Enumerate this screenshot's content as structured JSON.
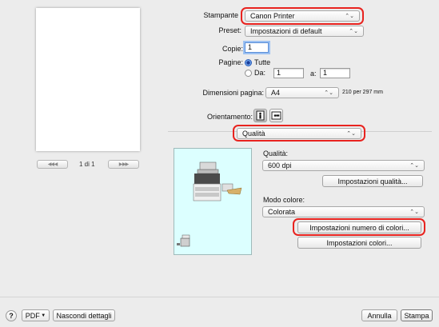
{
  "preview": {
    "page_indicator": "1 di 1",
    "first_icon": "◀◀ ◀",
    "last_icon": "▶ ▶▶"
  },
  "printer": {
    "label": "Stampante",
    "value": "Canon Printer"
  },
  "preset": {
    "label": "Preset:",
    "value": "Impostazioni di default"
  },
  "copies": {
    "label": "Copie:",
    "value": "1"
  },
  "pages": {
    "label": "Pagine:",
    "all_label": "Tutte",
    "from_label": "Da:",
    "from_value": "1",
    "to_label": "a:",
    "to_value": "1"
  },
  "paper": {
    "label": "Dimensioni pagina:",
    "value": "A4",
    "size_note": "210 per 297 mm"
  },
  "orientation": {
    "label": "Orientamento:"
  },
  "panel_menu": {
    "value": "Qualità"
  },
  "quality": {
    "label": "Qualità:",
    "resolution": "600 dpi",
    "settings_button": "Impostazioni qualità..."
  },
  "color": {
    "label": "Modo colore:",
    "value": "Colorata",
    "num_colors_button": "Impostazioni numero di colori...",
    "color_settings_button": "Impostazioni colori..."
  },
  "footer": {
    "help": "?",
    "pdf": "PDF",
    "hide_details": "Nascondi dettagli",
    "cancel": "Annulla",
    "print": "Stampa"
  },
  "highlight_color": "#e8231f",
  "popup_arrow": "⌃⌄"
}
